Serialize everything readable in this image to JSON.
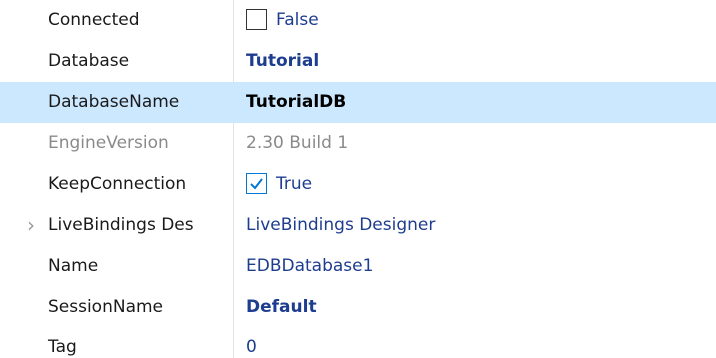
{
  "properties": [
    {
      "name": "Connected",
      "value": "False",
      "kind": "checkbox",
      "checked": false
    },
    {
      "name": "Database",
      "value": "Tutorial",
      "kind": "bold"
    },
    {
      "name": "DatabaseName",
      "value": "TutorialDB",
      "kind": "bold-black",
      "selected": true
    },
    {
      "name": "EngineVersion",
      "value": "2.30 Build 1",
      "kind": "disabled"
    },
    {
      "name": "KeepConnection",
      "value": "True",
      "kind": "checkbox",
      "checked": true
    },
    {
      "name": "LiveBindings Des",
      "value": "LiveBindings Designer",
      "kind": "plain",
      "expandable": true,
      "expander_icon": "chevron-right-icon"
    },
    {
      "name": "Name",
      "value": "EDBDatabase1",
      "kind": "plain"
    },
    {
      "name": "SessionName",
      "value": "Default",
      "kind": "bold"
    },
    {
      "name": "Tag",
      "value": "0",
      "kind": "plain"
    }
  ],
  "colors": {
    "selected_row": "#cce8ff",
    "value_text": "#1e3d8f",
    "disabled_text": "#8a8a8a",
    "checkbox_checked_border": "#0078d7"
  }
}
